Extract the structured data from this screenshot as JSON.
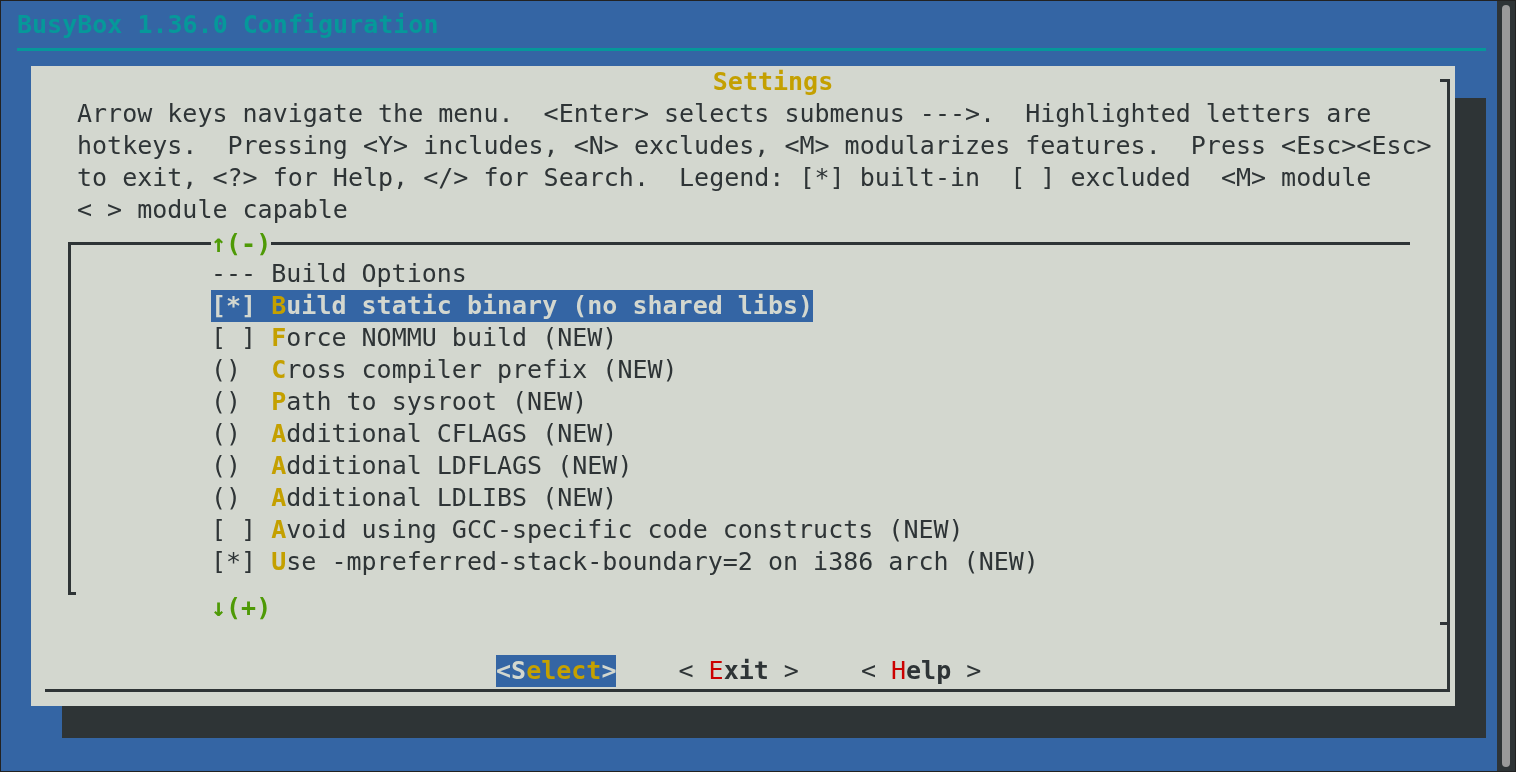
{
  "window": {
    "title": "BusyBox 1.36.0 Configuration"
  },
  "dialog": {
    "title": "Settings",
    "help_lines": [
      "Arrow keys navigate the menu.  <Enter> selects submenus --->.  Highlighted letters are",
      "hotkeys.  Pressing <Y> includes, <N> excludes, <M> modularizes features.  Press <Esc><Esc>",
      "to exit, <?> for Help, </> for Search.  Legend: [*] built-in  [ ] excluded  <M> module",
      "< > module capable"
    ],
    "scroll_up": "↑(-)",
    "scroll_down": "↓(+)",
    "items": [
      {
        "kind": "comment",
        "label": "--- Build Options",
        "selected": false
      },
      {
        "kind": "option",
        "prefix": "[*]",
        "hotkey": "B",
        "rest": "uild static binary (no shared libs)",
        "selected": true
      },
      {
        "kind": "option",
        "prefix": "[ ]",
        "hotkey": "F",
        "rest": "orce NOMMU build (NEW)",
        "selected": false
      },
      {
        "kind": "option",
        "prefix": "()",
        "hotkey": "C",
        "rest": "ross compiler prefix (NEW)",
        "selected": false
      },
      {
        "kind": "option",
        "prefix": "()",
        "hotkey": "P",
        "rest": "ath to sysroot (NEW)",
        "selected": false
      },
      {
        "kind": "option",
        "prefix": "()",
        "hotkey": "A",
        "rest": "dditional CFLAGS (NEW)",
        "selected": false
      },
      {
        "kind": "option",
        "prefix": "()",
        "hotkey": "A",
        "rest": "dditional LDFLAGS (NEW)",
        "selected": false
      },
      {
        "kind": "option",
        "prefix": "()",
        "hotkey": "A",
        "rest": "dditional LDLIBS (NEW)",
        "selected": false
      },
      {
        "kind": "option",
        "prefix": "[ ]",
        "hotkey": "A",
        "rest": "void using GCC-specific code constructs (NEW)",
        "selected": false
      },
      {
        "kind": "option",
        "prefix": "[*]",
        "hotkey": "U",
        "rest": "se -mpreferred-stack-boundary=2 on i386 arch (NEW)",
        "selected": false
      }
    ],
    "buttons": [
      {
        "open": "<",
        "hotkey": "S",
        "rest": "elect",
        "close": ">",
        "selected": true
      },
      {
        "open": "< ",
        "hotkey": "E",
        "rest": "xit",
        "close": " >",
        "selected": false
      },
      {
        "open": "< ",
        "hotkey": "H",
        "rest": "elp",
        "close": " >",
        "selected": false
      }
    ]
  }
}
